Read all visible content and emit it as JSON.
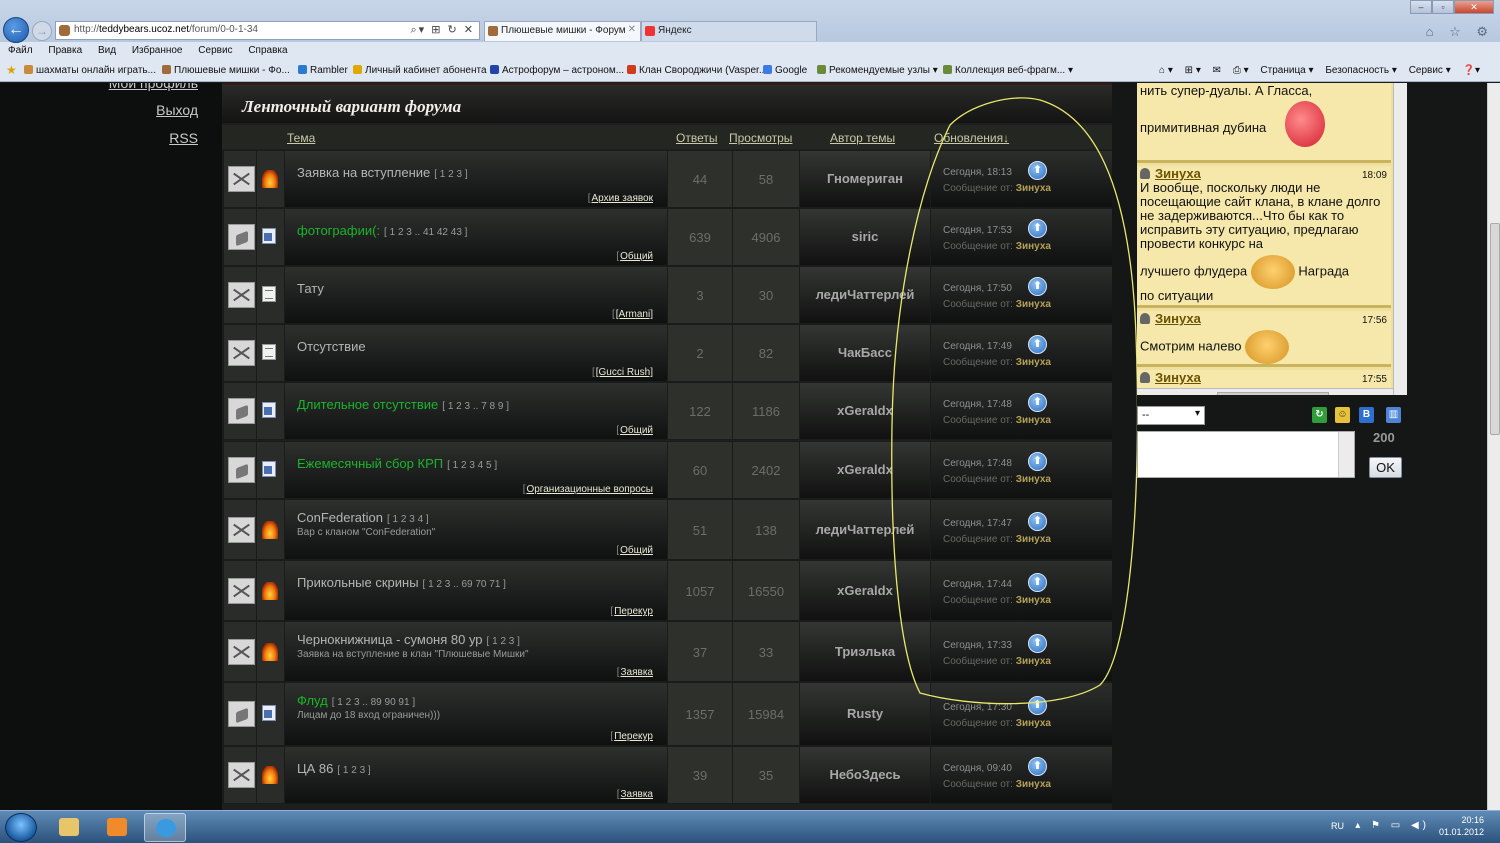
{
  "browser": {
    "url_prefix": "http://",
    "url_domain": "teddybears.ucoz.net",
    "url_path": "/forum/0-0-1-34",
    "addr_tools": "⌕▾ ⊞ ↻ ✕",
    "tabs": [
      {
        "label": "Плюшевые мишки - Форум",
        "close": "✕"
      },
      {
        "label": "Яндекс",
        "close": ""
      }
    ],
    "window_buttons": [
      "–",
      "▫",
      "✕"
    ],
    "top_icons": "⌂ ☆ ⚙",
    "menu": [
      "Файл",
      "Правка",
      "Вид",
      "Избранное",
      "Сервис",
      "Справка"
    ],
    "favorites": [
      {
        "label": "шахматы онлайн  играть...",
        "color": "#c88b3c"
      },
      {
        "label": "Плюшевые мишки - Фо...",
        "color": "#a06a3a"
      },
      {
        "label": "Rambler",
        "color": "#2a7ad1"
      },
      {
        "label": "Личный кабинет абонента",
        "color": "#e0a800"
      },
      {
        "label": "Астрофорум – астроном...",
        "color": "#2244aa"
      },
      {
        "label": "Клан Свороджичи (Vasper...",
        "color": "#d13a1a"
      },
      {
        "label": "Google",
        "color": "#3b7be8"
      },
      {
        "label": "Рекомендуемые узлы ▾",
        "color": "#6a8a3a"
      },
      {
        "label": "Коллекция веб-фрагм... ▾",
        "color": "#6a8a3a"
      }
    ],
    "commands": [
      "⌂ ▾",
      "⊞ ▾",
      "✉",
      "⎙ ▾",
      "Страница ▾",
      "Безопасность ▾",
      "Сервис ▾",
      "❓▾"
    ]
  },
  "leftnav": {
    "links": [
      "Мой профиль",
      "Выход",
      "RSS"
    ]
  },
  "forum": {
    "title": "Ленточный вариант форума",
    "columns": {
      "topic": "Тема",
      "replies": "Ответы",
      "views": "Просмотры",
      "author": "Автор темы",
      "updates": "Обновления↓"
    },
    "last_by_prefix": "Сообщение от:",
    "rows": [
      {
        "status": "closed",
        "type": "fire",
        "title": "Заявка на вступление",
        "green": false,
        "pages": "[ 1 2 3 ]",
        "desc": "",
        "category": "Архив заявок",
        "replies": "44",
        "views": "58",
        "author": "Гномериган",
        "updated": "Сегодня, 18:13",
        "last_by": "Зинуха"
      },
      {
        "status": "open",
        "type": "docp",
        "title": "фотографии(:",
        "green": true,
        "pages": "[ 1 2 3 .. 41 42 43 ]",
        "desc": "",
        "category": "Общий",
        "replies": "639",
        "views": "4906",
        "author": "siric",
        "updated": "Сегодня, 17:53",
        "last_by": "Зинуха"
      },
      {
        "status": "closed",
        "type": "doc",
        "title": "Тату",
        "green": false,
        "pages": "",
        "desc": "",
        "category": "[Armani]",
        "replies": "3",
        "views": "30",
        "author": "ледиЧаттерлей",
        "updated": "Сегодня, 17:50",
        "last_by": "Зинуха"
      },
      {
        "status": "closed",
        "type": "doc",
        "title": "Отсутствие",
        "green": false,
        "pages": "",
        "desc": "",
        "category": "[Gucci Rush]",
        "replies": "2",
        "views": "82",
        "author": "ЧакБасс",
        "updated": "Сегодня, 17:49",
        "last_by": "Зинуха"
      },
      {
        "status": "open",
        "type": "docp",
        "title": "Длительное отсутствие",
        "green": true,
        "pages": "[ 1 2 3 .. 7 8 9 ]",
        "desc": "",
        "category": "Общий",
        "replies": "122",
        "views": "1186",
        "author": "xGeraldx",
        "updated": "Сегодня, 17:48",
        "last_by": "Зинуха"
      },
      {
        "status": "open",
        "type": "docp",
        "title": "Ежемесячный сбор КРП",
        "green": true,
        "pages": "[ 1 2 3 4 5 ]",
        "desc": "",
        "category": "Организационные вопросы",
        "replies": "60",
        "views": "2402",
        "author": "xGeraldx",
        "updated": "Сегодня, 17:48",
        "last_by": "Зинуха"
      },
      {
        "status": "closed",
        "type": "fire",
        "title": "ConFederation",
        "green": false,
        "pages": "[ 1 2 3 4 ]",
        "desc": "Вар с кланом \"ConFederation\"",
        "category": "Общий",
        "replies": "51",
        "views": "138",
        "author": "ледиЧаттерлей",
        "updated": "Сегодня, 17:47",
        "last_by": "Зинуха"
      },
      {
        "status": "closed",
        "type": "fire",
        "title": "Прикольные скрины",
        "green": false,
        "pages": "[ 1 2 3 .. 69 70 71 ]",
        "desc": "",
        "category": "Перекур",
        "replies": "1057",
        "views": "16550",
        "author": "xGeraldx",
        "updated": "Сегодня, 17:44",
        "last_by": "Зинуха"
      },
      {
        "status": "closed",
        "type": "fire",
        "title": "Чернокнижница - сумоня 80 ур",
        "green": false,
        "pages": "[ 1 2 3 ]",
        "desc": "Заявка на вступление в клан \"Плюшевые Мишки\"",
        "category": "Заявка",
        "replies": "37",
        "views": "33",
        "author": "Триэлька",
        "updated": "Сегодня, 17:33",
        "last_by": "Зинуха"
      },
      {
        "status": "open",
        "type": "docp",
        "title": "Флуд",
        "green": true,
        "pages": "[ 1 2 3 .. 89 90 91 ]",
        "desc": "Лицам до 18 вход ограничен)))",
        "category": "Перекур",
        "replies": "1357",
        "views": "15984",
        "author": "Rusty",
        "updated": "Сегодня, 17:30",
        "last_by": "Зинуха"
      },
      {
        "status": "closed",
        "type": "fire",
        "title": "ЦА 86",
        "green": false,
        "pages": "[ 1 2 3 ]",
        "desc": "",
        "category": "Заявка",
        "replies": "39",
        "views": "35",
        "author": "НебоЗдесь",
        "updated": "Сегодня, 09:40",
        "last_by": "Зинуха"
      }
    ]
  },
  "chat": {
    "messages": [
      {
        "user": "",
        "time": "",
        "text_top": "нить супер-дуалы. А Гласса,",
        "text_bottom": "примитивная дубина",
        "smiley": "red"
      },
      {
        "user": "Зинуха",
        "time": "18:09",
        "text_top": "И вообще, поскольку люди не посещающие сайт клана, в клане долго не задерживаются...Что бы как то исправить эту ситуацию, предлагаю провести конкурс на",
        "text_bottom": "лучшего флудера",
        "text_after": "Награда",
        "text_tail": "по ситуации",
        "smiley": "bear"
      },
      {
        "user": "Зинуха",
        "time": "17:56",
        "text_top": "Смотрим налево",
        "text_bottom": "",
        "smiley": "bear"
      },
      {
        "user": "Зинуха",
        "time": "17:55",
        "text_top": "",
        "text_bottom": "",
        "smiley": ""
      }
    ],
    "select_value": "--",
    "toolbar_icons": [
      "refresh-icon",
      "smile-icon",
      "bold-icon",
      "panel-icon"
    ],
    "counter": "200",
    "ok_label": "OK"
  },
  "taskbar": {
    "lang": "RU",
    "tray_icons": "▴ ⚑ ▭ ◀)",
    "time": "20:16",
    "date": "01.01.2012"
  },
  "colors": {
    "green_topic": "#19b52b",
    "highlight_ellipse": "#e9e86a",
    "chat_bg": "#f5e8aa"
  }
}
